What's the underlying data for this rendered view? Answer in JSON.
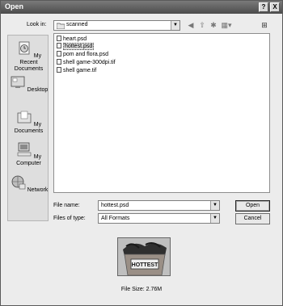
{
  "window": {
    "title": "Open",
    "help_glyph": "?",
    "close_glyph": "X"
  },
  "lookin": {
    "label": "Look in:",
    "value": "scanned",
    "folder_icon": "folder-icon",
    "tools": [
      "back-icon",
      "up-folder-icon",
      "new-folder-icon",
      "views-menu-icon"
    ],
    "right_icon": "add-to-favorites-icon"
  },
  "places": [
    {
      "label": "My Recent Documents",
      "icon": "recent-documents-icon"
    },
    {
      "label": "Desktop",
      "icon": "desktop-icon"
    },
    {
      "label": "My Documents",
      "icon": "my-documents-icon"
    },
    {
      "label": "My Computer",
      "icon": "my-computer-icon"
    },
    {
      "label": "Network",
      "icon": "network-icon"
    }
  ],
  "files": [
    {
      "name": "heart.psd",
      "selected": false
    },
    {
      "name": "hottest.psd",
      "selected": true
    },
    {
      "name": "pom and flora.psd",
      "selected": false
    },
    {
      "name": "shell game-300dpi.tif",
      "selected": false
    },
    {
      "name": "shell game.tif",
      "selected": false
    }
  ],
  "filename": {
    "label": "File name:",
    "value": "hottest.psd"
  },
  "filetype": {
    "label": "Files of type:",
    "value": "All Formats"
  },
  "buttons": {
    "open": "Open",
    "cancel": "Cancel"
  },
  "preview": {
    "sign_text": "HOTTEST"
  },
  "filesize": "File Size: 2.76M"
}
